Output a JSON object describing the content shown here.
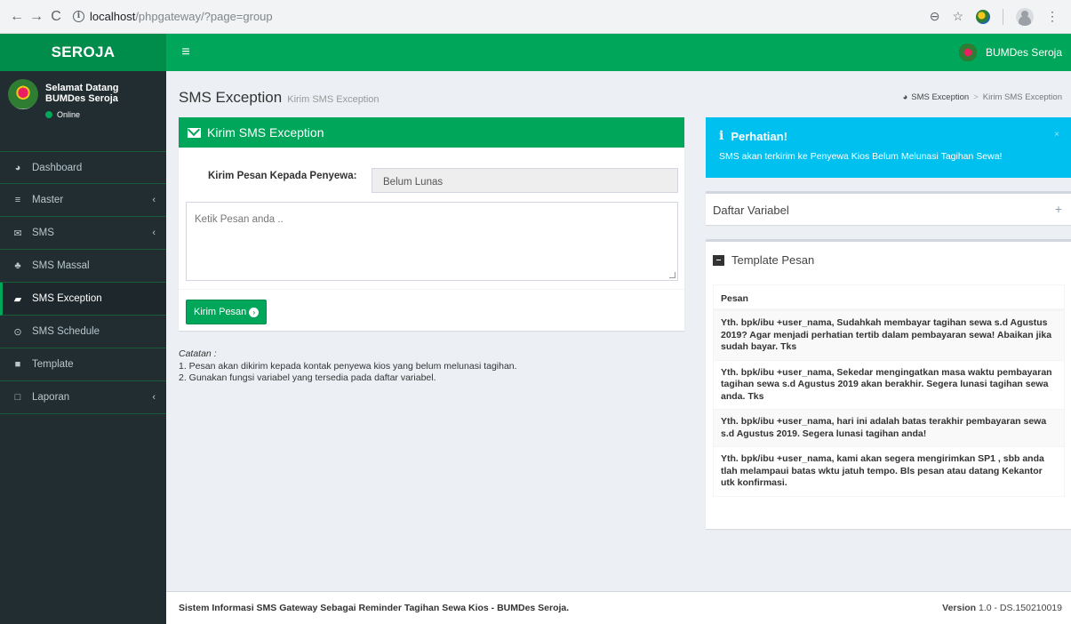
{
  "browser": {
    "url_host": "localhost",
    "url_path": "/phpgateway/?page=group"
  },
  "header": {
    "logo": "SEROJA",
    "toggle_icon": "hamburger-icon",
    "user_name": "BUMDes Seroja"
  },
  "sidebar": {
    "welcome_line1": "Selamat Datang",
    "welcome_line2": "BUMDes Seroja",
    "status": "Online",
    "status_color": "#00a65a",
    "items": [
      {
        "label": "Dashboard",
        "icon": "dashboard-icon",
        "submenu": false,
        "active": false
      },
      {
        "label": "Master",
        "icon": "bars-icon",
        "submenu": true,
        "active": false
      },
      {
        "label": "SMS",
        "icon": "envelope-icon",
        "submenu": true,
        "active": false
      },
      {
        "label": "SMS Massal",
        "icon": "users-icon",
        "submenu": false,
        "active": false
      },
      {
        "label": "SMS Exception",
        "icon": "book-icon",
        "submenu": false,
        "active": true
      },
      {
        "label": "SMS Schedule",
        "icon": "clock-icon",
        "submenu": false,
        "active": false
      },
      {
        "label": "Template",
        "icon": "archive-icon",
        "submenu": false,
        "active": false
      },
      {
        "label": "Laporan",
        "icon": "folder-icon",
        "submenu": true,
        "active": false
      }
    ]
  },
  "page": {
    "title": "SMS Exception",
    "subtitle": "Kirim SMS Exception",
    "breadcrumb_home": "SMS Exception",
    "breadcrumb_current": "Kirim SMS Exception"
  },
  "form": {
    "header": "Kirim SMS Exception",
    "recipient_label": "Kirim Pesan Kepada Penyewa:",
    "recipient_value": "Belum Lunas",
    "message_placeholder": "Ketik Pesan anda ..",
    "send_button": "Kirim Pesan"
  },
  "notes": {
    "title": "Catatan :",
    "line1": "1. Pesan akan dikirim kepada kontak penyewa kios yang belum melunasi tagihan.",
    "line2": "2. Gunakan fungsi variabel yang tersedia pada daftar variabel."
  },
  "callout": {
    "title": "Perhatian!",
    "message": "SMS akan terkirim ke Penyewa Kios Belum Melunasi Tagihan Sewa!",
    "color": "#00c0ef"
  },
  "variables_box": {
    "title": "Daftar Variabel"
  },
  "template_box": {
    "title": "Template Pesan",
    "column": "Pesan",
    "rows": [
      "Yth. bpk/ibu +user_nama, Sudahkah membayar tagihan sewa s.d Agustus 2019? Agar menjadi perhatian tertib dalam pembayaran sewa! Abaikan jika sudah bayar. Tks",
      "Yth. bpk/ibu +user_nama, Sekedar mengingatkan masa waktu pembayaran tagihan sewa s.d Agustus 2019 akan berakhir. Segera lunasi tagihan sewa anda. Tks",
      "Yth. bpk/ibu +user_nama, hari ini adalah batas terakhir pembayaran sewa s.d Agustus 2019. Segera lunasi tagihan anda!",
      "Yth. bpk/ibu +user_nama, kami akan segera mengirimkan SP1 , sbb anda tlah melampaui batas wktu jatuh tempo. Bls pesan atau datang Kekantor utk konfirmasi."
    ]
  },
  "footer": {
    "text": "Sistem Informasi SMS Gateway Sebagai Reminder Tagihan Sewa Kios - BUMDes Seroja.",
    "version_label": "Version",
    "version_value": "1.0 - DS.150210019"
  },
  "colors": {
    "brand": "#00a65a",
    "brand_dark": "#008d4c",
    "sidebar_bg": "#222d32"
  }
}
